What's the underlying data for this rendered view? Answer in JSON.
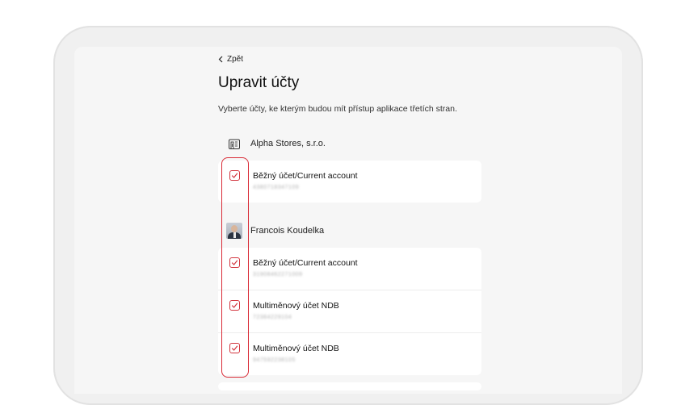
{
  "nav": {
    "back_label": "Zpět"
  },
  "page": {
    "title": "Upravit účty",
    "subtitle": "Vyberte účty, ke kterým budou mít přístup aplikace třetích stran."
  },
  "owners": [
    {
      "name": "Alpha Stores, s.r.o.",
      "icon": "building-icon",
      "accounts": [
        {
          "name": "Běžný účet/Current account",
          "number": "4380718347109",
          "checked": true
        }
      ]
    },
    {
      "name": "Francois Koudelka",
      "icon": "avatar-photo",
      "accounts": [
        {
          "name": "Běžný účet/Current account",
          "number": "31908462271009",
          "checked": true
        },
        {
          "name": "Multiměnový účet NDB",
          "number": "72384229104",
          "checked": true
        },
        {
          "name": "Multiměnový účet NDB",
          "number": "947592238105",
          "checked": true
        }
      ]
    }
  ],
  "colors": {
    "accent_red": "#d2353e",
    "highlight_red": "#d92b36",
    "card_bg": "#ffffff",
    "screen_bg": "#f6f6f6"
  }
}
